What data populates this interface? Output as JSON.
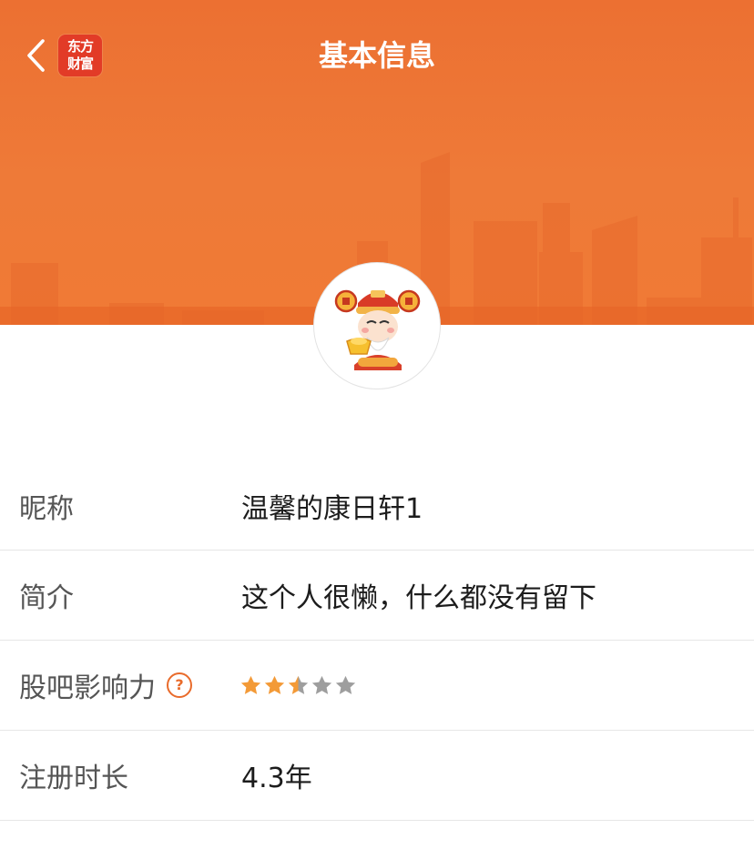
{
  "header": {
    "title": "基本信息",
    "logo_line1": "东方",
    "logo_line2": "财富",
    "color": "#ee7534"
  },
  "profile": {
    "avatar_icon": "god-of-wealth-avatar"
  },
  "info_rows": [
    {
      "label": "昵称",
      "value": "温馨的康日轩1"
    },
    {
      "label": "简介",
      "value": "这个人很懒，什么都没有留下"
    },
    {
      "label": "股吧影响力",
      "help_icon": "question-circle-icon",
      "rating": 2.5,
      "rating_max": 5
    },
    {
      "label": "注册时长",
      "value": "4.3年"
    }
  ],
  "colors": {
    "accent": "#e96b2b",
    "star_filled": "#f39a37",
    "star_empty": "#9e9e9e"
  }
}
